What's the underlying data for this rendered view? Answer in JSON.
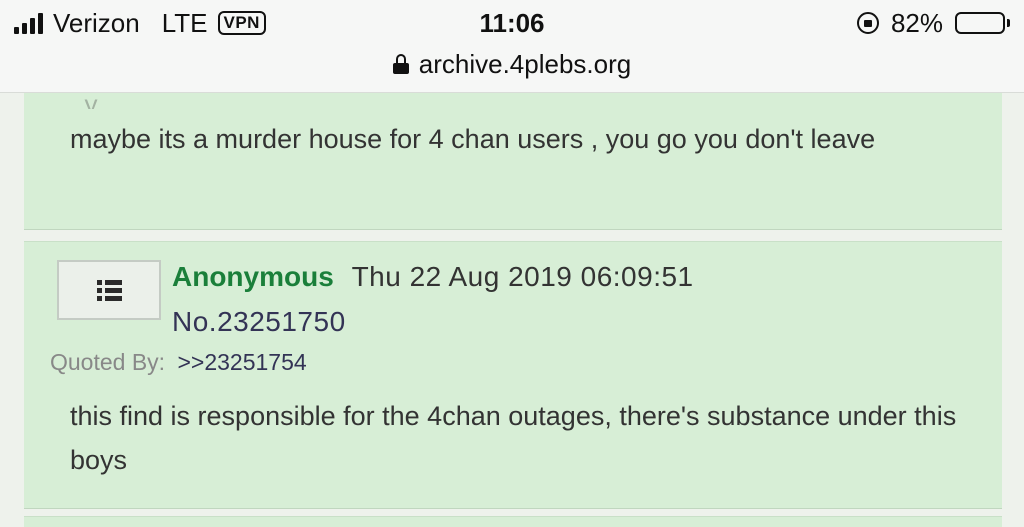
{
  "status_bar": {
    "carrier": "Verizon",
    "network": "LTE",
    "vpn": "VPN",
    "time": "11:06",
    "battery_percent": "82%",
    "battery_level": 0.82,
    "icons": [
      "signal-icon",
      "rotation-lock-icon",
      "battery-icon"
    ]
  },
  "address_bar": {
    "url": "archive.4plebs.org",
    "icon": "lock-icon"
  },
  "posts": [
    {
      "text": "maybe its a murder house for 4 chan users , you go you don't leave"
    },
    {
      "thumbnail_icon": "list-icon",
      "name": "Anonymous",
      "date": "Thu 22 Aug 2019 06:09:51",
      "number": "No.23251750",
      "quoted_by_label": "Quoted By:",
      "quoted_by_link": ">>23251754",
      "text": "this find is responsible for the 4chan outages, there's substance under this boys"
    }
  ],
  "colors": {
    "post_background": "#d7eed6",
    "poster_name": "#1a7f3a",
    "link": "#333355"
  }
}
